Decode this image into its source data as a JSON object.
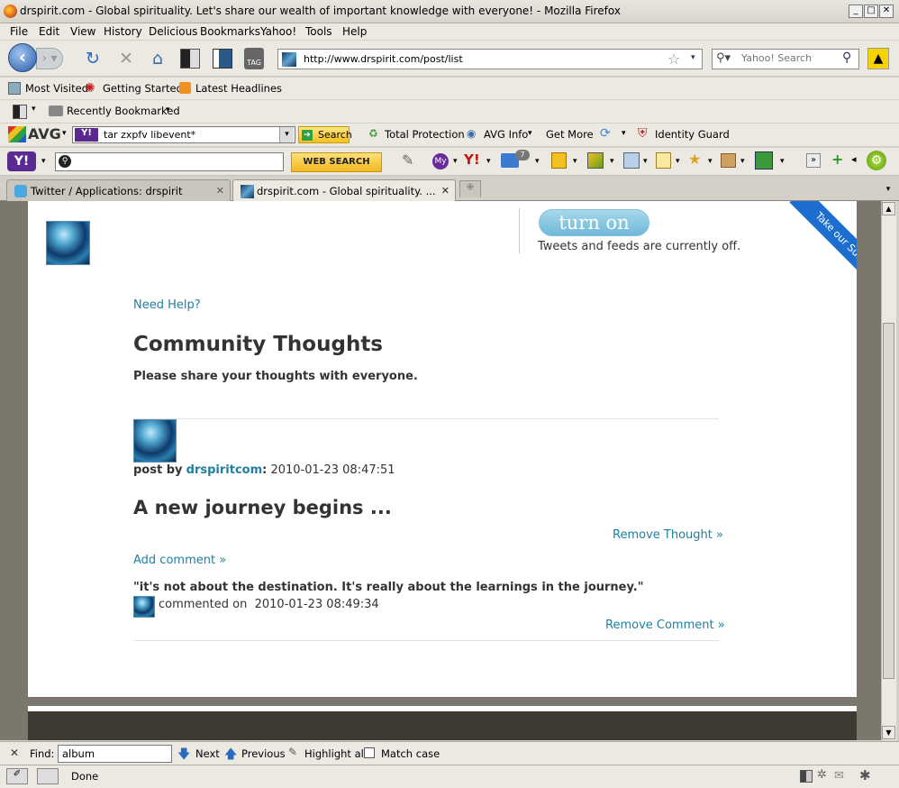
{
  "window": {
    "title": "drspirit.com - Global spirituality. Let's share our wealth of important knowledge with everyone! - Mozilla Firefox"
  },
  "menus": [
    "File",
    "Edit",
    "View",
    "History",
    "Delicious",
    "Bookmarks",
    "Yahoo!",
    "Tools",
    "Help"
  ],
  "nav": {
    "url": "http://www.drspirit.com/post/list",
    "search_placeholder": "Yahoo! Search",
    "tag_label": "TAG"
  },
  "bookmarks": [
    "Most Visited",
    "Getting Started",
    "Latest Headlines"
  ],
  "recently_bookmarked": "Recently Bookmarked",
  "avg": {
    "logo": "AVG",
    "query": "tar zxpfv libevent*",
    "search_label": "Search",
    "items": [
      "Total Protection",
      "AVG Info",
      "Get More",
      "Identity Guard"
    ],
    "yahoo_logo": "Y!"
  },
  "yahoo": {
    "logo": "Y!",
    "web_search": "WEB SEARCH",
    "my_label": "My",
    "mail_count": "7"
  },
  "tabs": [
    {
      "label": "Twitter / Applications: drspirit"
    },
    {
      "label": "drspirit.com - Global spirituality. ..."
    }
  ],
  "page": {
    "turn_on": "turn on",
    "tweets_status": "Tweets and feeds are currently off.",
    "survey": "Take our Survey",
    "need_help": "Need Help?",
    "heading": "Community Thoughts",
    "subheading": "Please share your thoughts with everyone.",
    "post": {
      "by_label": "post by",
      "author": "drspiritcom",
      "colon": ":",
      "date": "2010-01-23 08:47:51",
      "title": "A new journey begins ...",
      "remove_thought": "Remove Thought »",
      "add_comment": "Add comment »"
    },
    "comment": {
      "text": "\"it's not about the destination. It's really about the learnings in the journey.\"",
      "meta_label": "commented on",
      "date": "2010-01-23 08:49:34",
      "remove": "Remove Comment »"
    }
  },
  "findbar": {
    "label": "Find:",
    "value": "album",
    "next": "Next",
    "previous": "Previous",
    "highlight": "Highlight all",
    "match_case": "Match case"
  },
  "status": {
    "text": "Done"
  }
}
